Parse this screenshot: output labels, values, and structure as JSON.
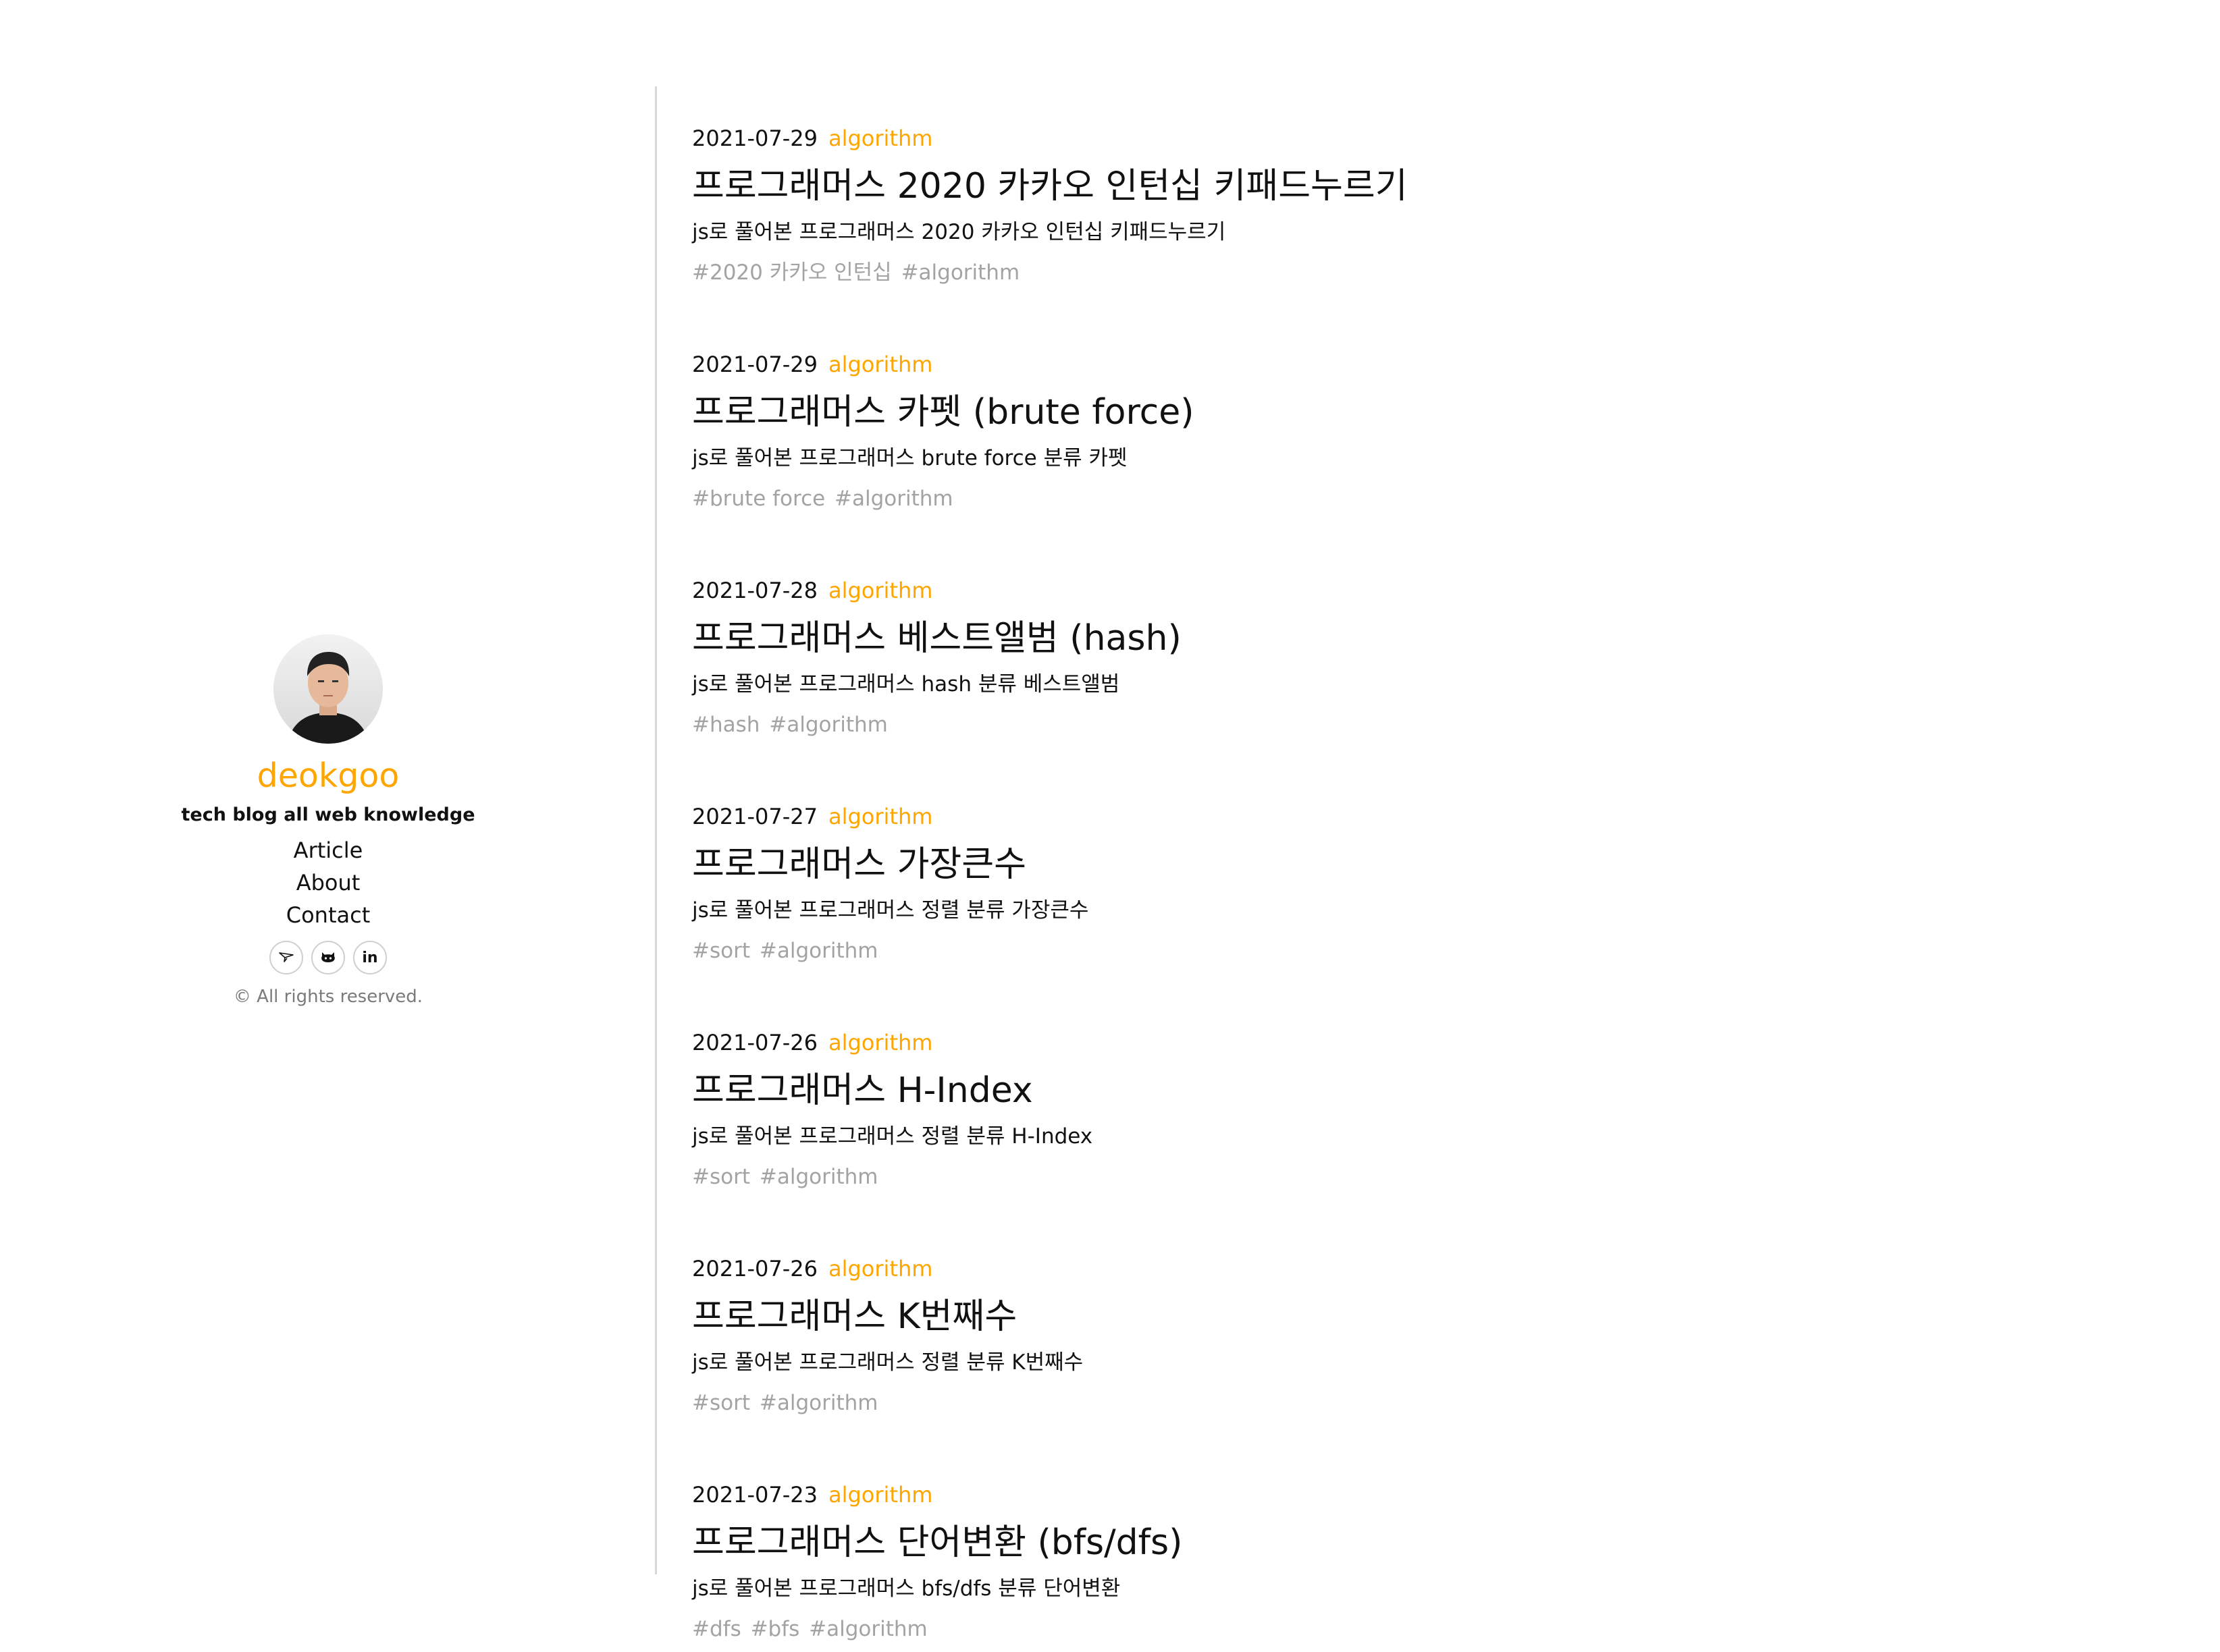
{
  "sidebar": {
    "author_name": "deokgoo",
    "bio": "tech blog all web knowledge",
    "nav": [
      "Article",
      "About",
      "Contact"
    ],
    "socials": [
      {
        "icon": "mail-icon"
      },
      {
        "icon": "github-icon"
      },
      {
        "icon": "linkedin-icon",
        "text": "in"
      }
    ],
    "copyright": "© All rights reserved."
  },
  "posts": [
    {
      "date": "2021-07-29",
      "category": "algorithm",
      "title": "프로그래머스 2020 카카오 인턴십 키패드누르기",
      "description": "js로 풀어본 프로그래머스 2020 카카오 인턴십 키패드누르기",
      "tags": [
        "#2020 카카오 인턴십",
        "#algorithm"
      ]
    },
    {
      "date": "2021-07-29",
      "category": "algorithm",
      "title": "프로그래머스 카펫 (brute force)",
      "description": "js로 풀어본 프로그래머스 brute force 분류 카펫",
      "tags": [
        "#brute force",
        "#algorithm"
      ]
    },
    {
      "date": "2021-07-28",
      "category": "algorithm",
      "title": "프로그래머스 베스트앨범 (hash)",
      "description": "js로 풀어본 프로그래머스 hash 분류 베스트앨범",
      "tags": [
        "#hash",
        "#algorithm"
      ]
    },
    {
      "date": "2021-07-27",
      "category": "algorithm",
      "title": "프로그래머스 가장큰수",
      "description": "js로 풀어본 프로그래머스 정렬 분류 가장큰수",
      "tags": [
        "#sort",
        "#algorithm"
      ]
    },
    {
      "date": "2021-07-26",
      "category": "algorithm",
      "title": "프로그래머스 H-Index",
      "description": "js로 풀어본 프로그래머스 정렬 분류 H-Index",
      "tags": [
        "#sort",
        "#algorithm"
      ]
    },
    {
      "date": "2021-07-26",
      "category": "algorithm",
      "title": "프로그래머스 K번째수",
      "description": "js로 풀어본 프로그래머스 정렬 분류 K번째수",
      "tags": [
        "#sort",
        "#algorithm"
      ]
    },
    {
      "date": "2021-07-23",
      "category": "algorithm",
      "title": "프로그래머스 단어변환 (bfs/dfs)",
      "description": "js로 풀어본 프로그래머스 bfs/dfs 분류 단어변환",
      "tags": [
        "#dfs",
        "#bfs",
        "#algorithm"
      ]
    }
  ],
  "colors": {
    "accent": "#fea500",
    "text": "#111111",
    "tag": "#a3a3a3",
    "muted": "#7a7a7a",
    "divider": "#d8d8d8"
  }
}
